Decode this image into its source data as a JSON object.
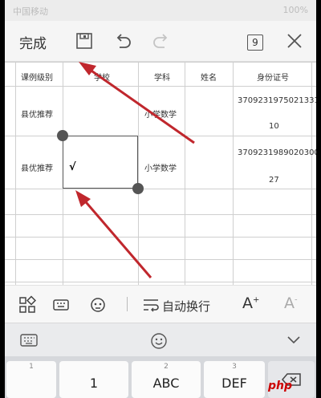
{
  "status_bar": {
    "left": "中国移动",
    "right": "100%"
  },
  "toolbar": {
    "done_label": "完成",
    "page_count": "9"
  },
  "sheet": {
    "headers": [
      "课例级别",
      "学校",
      "学科",
      "姓名",
      "身份证号"
    ],
    "rows": [
      {
        "level": "县优推荐",
        "subject": "小学数学",
        "id_line1": "370923197502133​1",
        "id_line2": "10"
      },
      {
        "level": "县优推荐",
        "cursor": "√",
        "subject": "小学数学",
        "id_line1": "3709231989020300",
        "id_line2": "27"
      }
    ]
  },
  "format_bar": {
    "wrap_label": "自动换行",
    "font_increase": "A",
    "font_decrease": "A",
    "plus": "+",
    "minus": "-"
  },
  "keyboard": {
    "keys": [
      {
        "sub": "1",
        "main": ""
      },
      {
        "sub": "",
        "main": "1"
      },
      {
        "sub": "2",
        "main": "ABC"
      },
      {
        "sub": "3",
        "main": "DEF"
      }
    ]
  },
  "watermark": "php",
  "colors": {
    "arrow": "#c0272d",
    "accent": "#555555"
  }
}
